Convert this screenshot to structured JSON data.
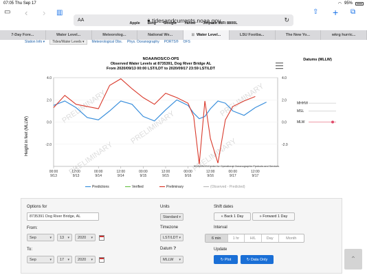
{
  "status": {
    "time": "07:05",
    "date": "Thu Sep 17",
    "battery": "95%"
  },
  "toolbar": {
    "aa": "AA",
    "url": "tidesandcurrents.noaa.gov"
  },
  "bookmarks": [
    "Apple",
    "Bing",
    "Google",
    "Yahoo",
    "Jetpack MiFi 8800L"
  ],
  "tabs": [
    "7-Day Fore...",
    "Water Level...",
    "Meteorolog...",
    "National We...",
    "Water Level...",
    "LSU Footba...",
    "The New Yo...",
    "wkrg hurric..."
  ],
  "active_tab": 4,
  "nav": [
    "Station Info ▾",
    "Tides/Water Levels ▾",
    "Meteorological Obs.",
    "Phys. Oceanography",
    "PORTS®",
    "OFS"
  ],
  "chart": {
    "title1": "NOAA/NOS/CO-OPS",
    "title2": "Observed Water Levels at 8735391, Dog River Bridge AL",
    "title3": "From 2020/09/13 00:00 LST/LDT to 2020/09/17 23:59 LST/LDT",
    "ylabel": "Height in feet (MLLW)",
    "credit": "NOAA/NOS/Center for Operational Oceanographic Products and Services",
    "watermark": "PRELIMINARY",
    "datums_title": "Datums (MLLW)",
    "datum_labels": [
      "MHHW",
      "MSL",
      "MLW"
    ],
    "legend": [
      "Predictions",
      "Verified",
      "Preliminary",
      "(Observed - Predicted)"
    ],
    "colors": {
      "predictions": "#3a8fdc",
      "verified": "#6cc24a",
      "preliminary": "#d9392b",
      "diff": "#bbbbbb"
    }
  },
  "chart_data": {
    "type": "line",
    "title": "Observed Water Levels at 8735391, Dog River Bridge AL",
    "xlabel": "",
    "ylabel": "Height in feet (MLLW)",
    "ylim": [
      -4.0,
      4.0
    ],
    "yticks": [
      "4.0",
      "2.0",
      "0.0",
      "-2.0"
    ],
    "xticks": [
      "00:00\n9/13",
      "12:00\n9/13",
      "00:00\n9/14",
      "12:00\n9/14",
      "00:00\n9/15",
      "12:00\n9/15",
      "00:00\n9/16",
      "12:00\n9/16",
      "00:00\n9/17",
      "12:00\n9/17"
    ],
    "x": [
      0,
      6,
      12,
      18,
      24,
      30,
      36,
      42,
      48,
      54,
      60,
      66,
      72,
      75,
      78,
      81,
      84,
      88,
      92,
      96,
      102,
      108,
      114
    ],
    "series": [
      {
        "name": "Predictions",
        "values": [
          1.5,
          1.9,
          1.3,
          0.4,
          0.2,
          1.0,
          1.9,
          1.6,
          0.5,
          0.1,
          1.1,
          2.0,
          1.5,
          0.8,
          0.3,
          0.5,
          1.2,
          1.9,
          1.7,
          1.0,
          0.6,
          1.3,
          1.8
        ]
      },
      {
        "name": "Preliminary",
        "values": [
          1.3,
          2.4,
          1.6,
          1.4,
          1.2,
          3.3,
          3.9,
          3.0,
          2.2,
          1.6,
          2.6,
          2.2,
          1.7,
          0.5,
          -3.8,
          1.9,
          -1.5,
          -3.7,
          0.2,
          1.4,
          1.9,
          2.3,
          null
        ]
      }
    ],
    "datums": {
      "MHHW": 1.7,
      "MSL": 1.0,
      "MLW": 0.0
    }
  },
  "form": {
    "options_for": "Options for",
    "station": "8735391 Dog River Bridge, AL",
    "from": "From:",
    "from_month": "Sep",
    "from_day": "13",
    "from_year": "2020",
    "to": "To:",
    "to_month": "Sep",
    "to_day": "17",
    "to_year": "2020",
    "units_label": "Units",
    "units": "Standard",
    "timezone_label": "Timezone",
    "timezone": "LST/LDT",
    "datum_label": "Datum",
    "datum": "MLLW",
    "shift_label": "Shift dates",
    "back": "Back 1 Day",
    "forward": "Forward 1 Day",
    "interval_label": "Interval",
    "intervals": [
      "6 min",
      "1 hr",
      "H/L",
      "Day",
      "Month"
    ],
    "interval_active": 0,
    "update_label": "Update",
    "plot": "Plot",
    "data_only": "Data Only"
  }
}
